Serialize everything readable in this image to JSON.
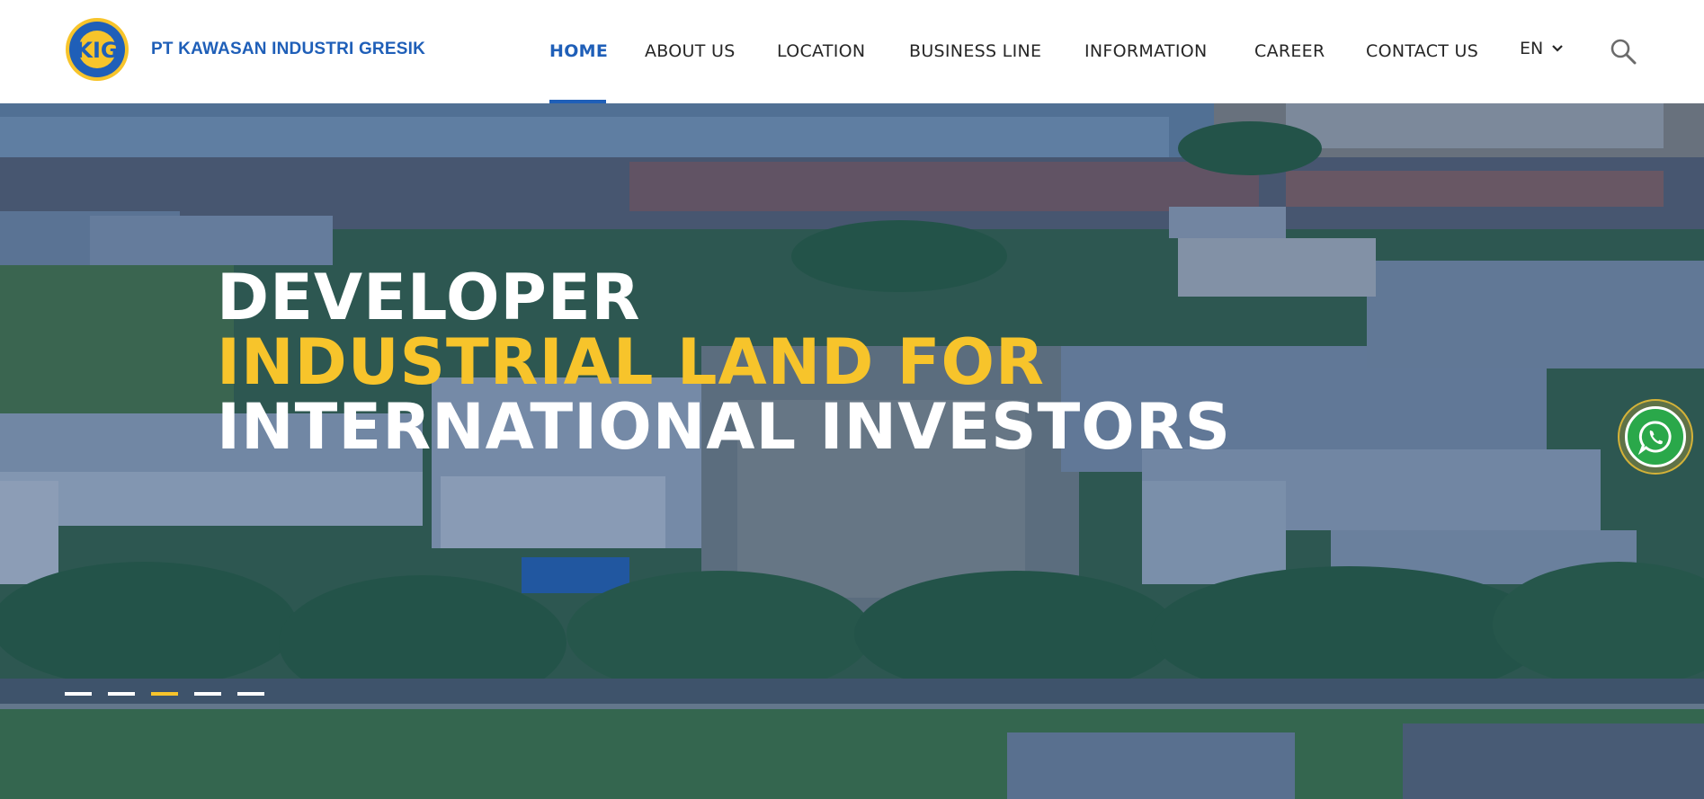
{
  "brand": {
    "name": "PT KAWASAN INDUSTRI GRESIK",
    "logo_text": "KIG"
  },
  "nav": {
    "items": [
      {
        "label": "HOME",
        "active": true
      },
      {
        "label": "ABOUT US",
        "active": false
      },
      {
        "label": "LOCATION",
        "active": false
      },
      {
        "label": "BUSINESS LINE",
        "active": false
      },
      {
        "label": "INFORMATION",
        "active": false
      },
      {
        "label": "CAREER",
        "active": false
      },
      {
        "label": "CONTACT US",
        "active": false
      }
    ],
    "language": "EN",
    "search_icon": "search-icon"
  },
  "hero": {
    "line1": "DEVELOPER",
    "line2": "INDUSTRIAL LAND FOR",
    "line3": "INTERNATIONAL INVESTORS",
    "slides_total": 5,
    "active_slide": 3
  },
  "whatsapp_icon": "whatsapp-icon",
  "colors": {
    "brand_blue": "#1f5fb8",
    "accent_yellow": "#f7c42b",
    "whatsapp_green": "#2aa84a"
  }
}
